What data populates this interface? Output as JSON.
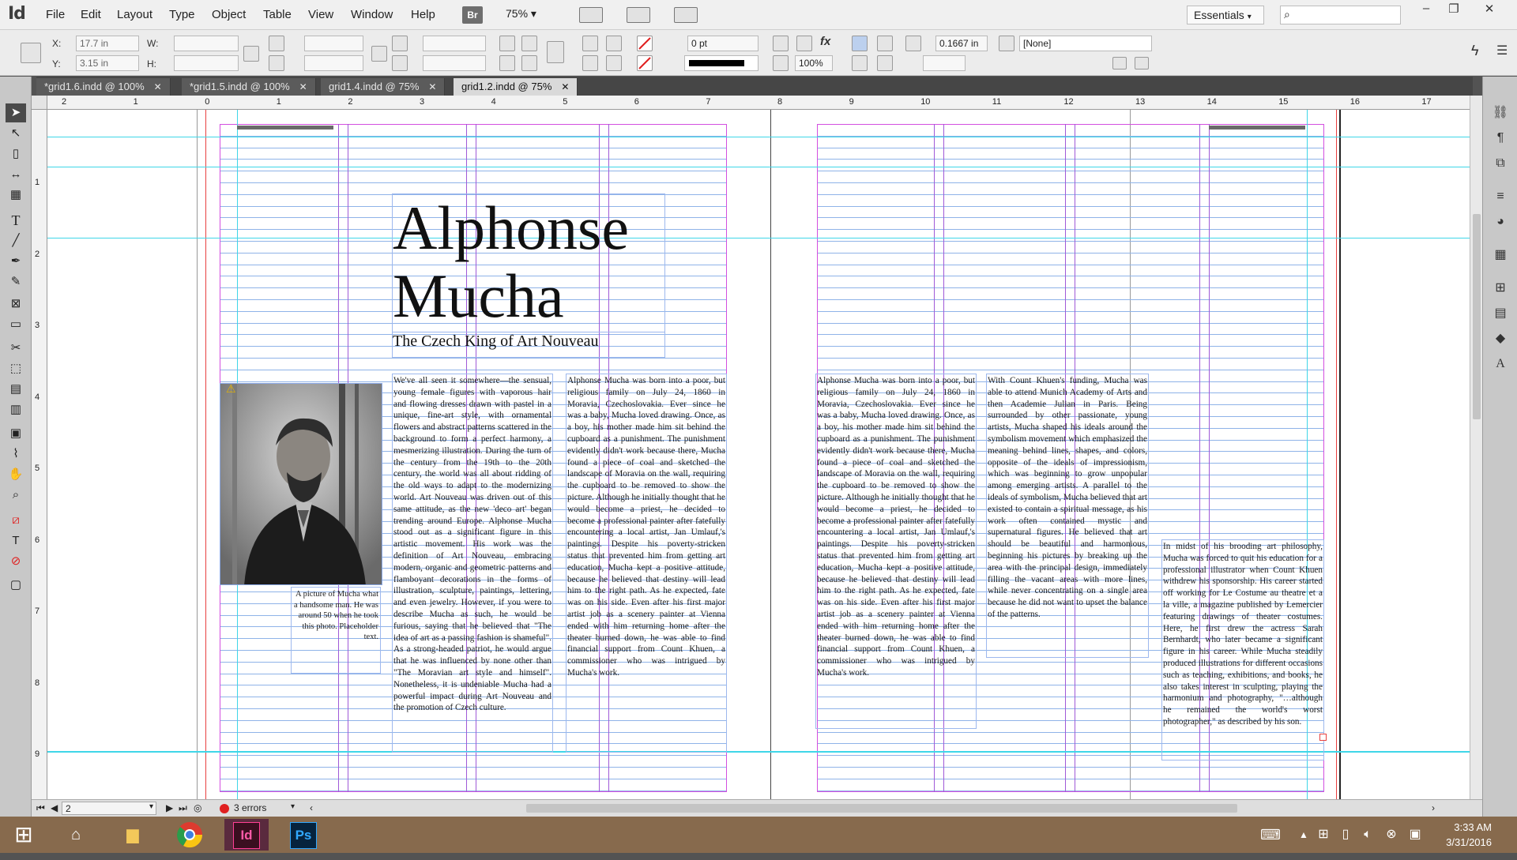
{
  "app": {
    "logo": "Id"
  },
  "menu": [
    "File",
    "Edit",
    "Layout",
    "Type",
    "Object",
    "Table",
    "View",
    "Window",
    "Help"
  ],
  "toolbar": {
    "bridge": "Br",
    "zoom": "75%",
    "workspace": "Essentials",
    "search_placeholder": ""
  },
  "control": {
    "x_label": "X:",
    "x_value": "17.7 in",
    "y_label": "Y:",
    "y_value": "3.15 in",
    "w_label": "W:",
    "h_label": "H:",
    "stroke_weight": "0 pt",
    "opacity": "100%",
    "offset": "0.1667 in",
    "object_style": "[None]"
  },
  "tabs": [
    {
      "label": "*grid1.6.indd @ 100%"
    },
    {
      "label": "*grid1.5.indd @ 100%"
    },
    {
      "label": "grid1.4.indd @ 75%"
    },
    {
      "label": "grid1.2.indd @ 75%"
    }
  ],
  "ruler": {
    "h": [
      "2",
      "1",
      "0",
      "1",
      "2",
      "3",
      "4",
      "5",
      "6",
      "7",
      "8",
      "9",
      "10",
      "11",
      "12",
      "13",
      "14",
      "15",
      "16",
      "17"
    ],
    "v": [
      "1",
      "2",
      "3",
      "4",
      "5",
      "6",
      "7",
      "8",
      "9"
    ]
  },
  "article": {
    "headline_line1": "Alphonse",
    "headline_line2": "Mucha",
    "subhead": "The Czech King of Art Nouveau",
    "caption": "A picture of Mucha what a handsome man. He was around 50 when he took this photo. Placeholder text.",
    "col1": "We've all seen it somewhere—the sensual, young female figures with vaporous hair and flowing dresses drawn with pastel in a unique, fine-art style, with ornamental flowers and abstract patterns scattered in the background to form a perfect harmony, a mesmerizing illustration. During the turn of the century from the 19th to the 20th century, the world was all about ridding of the old ways to adapt to the modernizing world. Art Nouveau was driven out of this same attitude, as the new 'deco art' began trending around Europe. Alphonse Mucha stood out as a significant figure in this artistic movement. His work was the definition of Art Nouveau, embracing modern, organic and geometric patterns and flamboyant decorations in the forms of illustration, sculpture, paintings, lettering, and even jewelry. However, if you were to describe Mucha as such, he would be furious, saying that he believed that \"The idea of art as a passing fashion is shameful\". As a strong-headed patriot, he would argue that he was influenced by none other than \"The Moravian art style and himself\". Nonetheless, it is undeniable Mucha had a powerful impact during Art Nouveau and the promotion of Czech culture.",
    "col2": "Alphonse Mucha was born into a poor, but religious family on July 24, 1860 in Moravia, Czechoslovakia. Ever since he was a baby, Mucha loved drawing. Once, as a boy, his mother made him sit behind the cupboard as a punishment. The punishment evidently didn't work because there, Mucha found a piece of coal and sketched the landscape of Moravia on the wall, requiring the cupboard to be removed to show the picture. Although he initially thought that he would become a priest, he decided to become a professional painter after fatefully encountering a local artist, Jan Umlauf,'s paintings. Despite his poverty-stricken status that prevented him from getting art education, Mucha kept a positive attitude, because he believed that destiny will lead him to the right path. As he expected, fate was on his side. Even after his first major artist job as a scenery painter at Vienna ended with him returning home after the theater burned down, he was able to find financial support from Count Khuen, a commissioner who was intrigued by Mucha's work.",
    "col3": "Alphonse Mucha was born into a poor, but religious family on July 24, 1860 in Moravia, Czechoslovakia. Ever since he was a baby, Mucha loved drawing. Once, as a boy, his mother made him sit behind the cupboard as a punishment. The punishment evidently didn't work because there, Mucha found a piece of coal and sketched the landscape of Moravia on the wall, requiring the cupboard to be removed to show the picture. Although he initially thought that he would become a priest, he decided to become a professional painter after fatefully encountering a local artist, Jan Umlauf,'s paintings. Despite his poverty-stricken status that prevented him from getting art education, Mucha kept a positive attitude, because he believed that destiny will lead him to the right path. As he expected, fate was on his side. Even after his first major artist job as a scenery painter at Vienna ended with him returning home after the theater burned down, he was able to find financial support from Count Khuen, a commissioner who was intrigued by Mucha's work.",
    "col4": "With Count Khuen's funding, Mucha was able to attend Munich Academy of Arts and then Academie Julian in Paris. Being surrounded by other passionate, young artists, Mucha shaped his ideals around the symbolism movement which emphasized the meaning behind lines, shapes, and colors, opposite of the ideals of impressionism, which was beginning to grow unpopular among emerging artists. A parallel to the ideals of symbolism, Mucha believed that art existed to contain a spiritual message, as his work often contained mystic and supernatural figures. He believed that art should be beautiful and harmonious, beginning his pictures by breaking up the area with the principal design, immediately filling the vacant areas with more lines, while never concentrating on a single area because he did not want to upset the balance of the patterns.",
    "col5": "In midst of his brooding art philosophy, Mucha was forced to quit his education for a professional illustrator when Count Khuen withdrew his sponsorship. His career started off working for Le Costume au theatre et a la ville, a magazine published by Lemercier featuring drawings of theater costumes. Here, he first drew the actress Sarah Bernhardt, who later became a significant figure in his career. While Mucha steadily produced illustrations for different occasions such as teaching, exhibitions, and books, he also takes interest in sculpting, playing the harmonium and photography, \"…although he remained the world's worst photographer,\" as described by his son."
  },
  "status": {
    "page": "2",
    "errors": "3 errors"
  },
  "taskbar": {
    "time": "3:33 AM",
    "date": "3/31/2016"
  }
}
